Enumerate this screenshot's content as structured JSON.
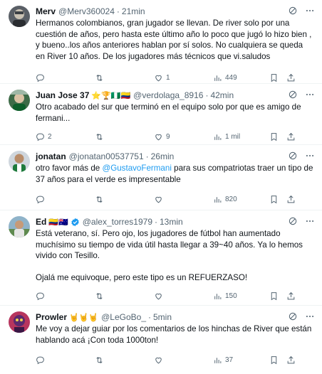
{
  "tweets": [
    {
      "name": "Merv",
      "name_badges": "",
      "handle": "@Merv360024",
      "time": "21min",
      "text": [
        "Hermanos colombianos, gran jugador se llevan. De river solo por una cuestión de años, pero hasta este último año lo poco que jugó lo hizo bien , y bueno..los años anteriores hablan por sí solos. No cualquiera se queda en River 10 años. De los jugadores más técnicos que vi.saludos"
      ],
      "replies": "",
      "retweets": "",
      "likes": "1",
      "views": "449"
    },
    {
      "name": "Juan Jose 37",
      "name_badges": "⭐🏆🇳🇬🇨🇴",
      "handle": "@verdolaga_8916",
      "time": "42min",
      "text": [
        "Otro acabado del sur que terminó en el equipo solo por que es amigo de fermani..."
      ],
      "replies": "2",
      "retweets": "",
      "likes": "9",
      "views": "1 mil"
    },
    {
      "name": "jonatan",
      "name_badges": "",
      "handle": "@jonatan00537751",
      "time": "26min",
      "text_prefix": "otro favor más de ",
      "mention": "@GustavoFermani",
      "text_suffix": " para sus compatriotas traer un tipo de 37 años para el verde es impresentable",
      "replies": "",
      "retweets": "",
      "likes": "",
      "views": "820"
    },
    {
      "name": "Ed",
      "name_badges": "🇨🇴🇦🇺",
      "handle": "@alex_torres1979",
      "time": "13min",
      "text": [
        "Está veterano, sí. Pero ojo, los jugadores de fútbol han aumentado muchísimo su tiempo de vida útil hasta llegar a 39~40 años. Ya lo hemos vivido con Tesillo.",
        "Ojalá me equivoque, pero este tipo es un REFUERZASO!"
      ],
      "replies": "",
      "retweets": "",
      "likes": "",
      "views": "150"
    },
    {
      "name": "Prowler",
      "name_badges": "🤘🤘🤘",
      "handle": "@LeGoBo_",
      "time": "5min",
      "text": [
        "Me voy a dejar guiar por los comentarios de los hinchas de River que están hablando acá ¡Con toda 1000ton!"
      ],
      "replies": "",
      "retweets": "",
      "likes": "",
      "views": "37"
    }
  ],
  "separator": "·",
  "colors": {
    "text": "#0f1419",
    "secondary": "#536471",
    "link": "#1d9bf0",
    "verified": "#1d9bf0",
    "border": "#eff3f4"
  },
  "icons": [
    "grok-icon",
    "more-icon",
    "reply-icon",
    "retweet-icon",
    "like-icon",
    "views-icon",
    "bookmark-icon",
    "share-icon"
  ]
}
